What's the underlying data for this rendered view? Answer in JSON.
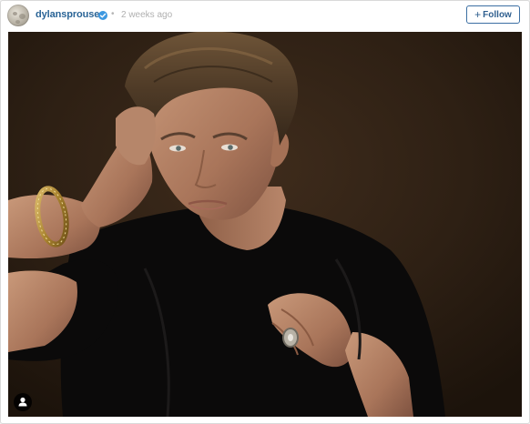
{
  "post": {
    "username": "dylansprouse",
    "verified": true,
    "separator": "•",
    "timestamp": "2 weeks ago",
    "follow_label": "Follow",
    "follow_plus": "+",
    "photo_caption_alt": "",
    "user_tag_icon": "person-icon"
  },
  "colors": {
    "link": "#2a6496",
    "button_border": "#3c6fa3",
    "verified": "#3d98e0",
    "muted": "#b0b0b0"
  }
}
